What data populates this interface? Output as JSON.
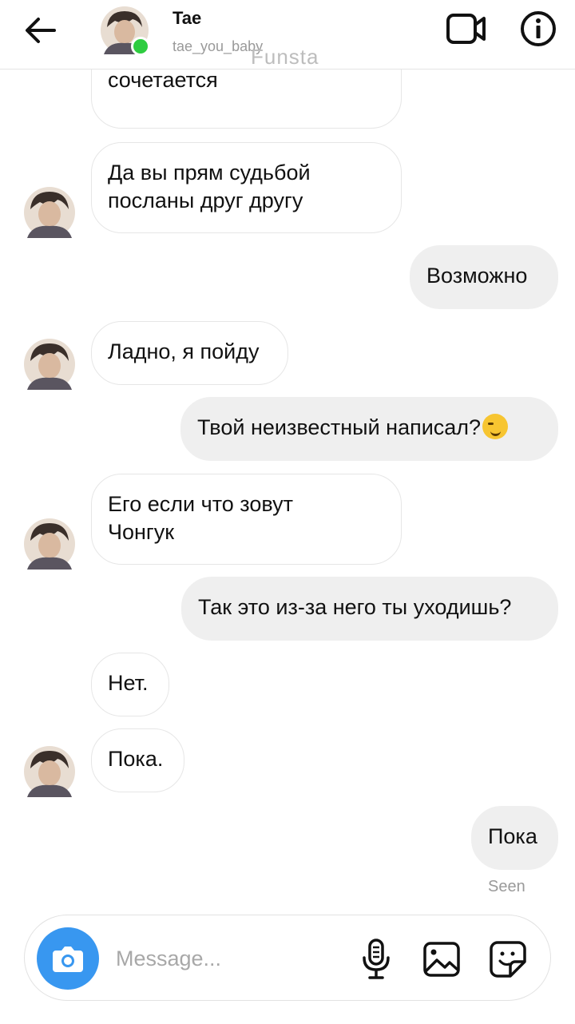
{
  "header": {
    "name": "Tae",
    "username": "tae_you_baby",
    "watermark": "Funsta",
    "icons": [
      "back-arrow-icon",
      "video-camera-icon",
      "info-icon"
    ],
    "online_color": "#2ecc40"
  },
  "messages": [
    {
      "from": "them",
      "text": "карамель прекрасно\nсочетается",
      "avatar": false
    },
    {
      "from": "them",
      "text": "Да вы прям судьбой\nпосланы друг другу",
      "avatar": true
    },
    {
      "from": "me",
      "text": "Возможно"
    },
    {
      "from": "them",
      "text": "Ладно, я пойду",
      "avatar": true
    },
    {
      "from": "me",
      "text": "Твой неизвестный написал?",
      "emoji": "smirking-face"
    },
    {
      "from": "them",
      "text": "Его если что зовут\nЧонгук",
      "avatar": true
    },
    {
      "from": "me",
      "text": "Так это из-за него ты уходишь?"
    },
    {
      "from": "them",
      "text": "Нет.",
      "avatar": false
    },
    {
      "from": "them",
      "text": "Пока.",
      "avatar": true
    },
    {
      "from": "me",
      "text": "Пока"
    }
  ],
  "seen_label": "Seen",
  "composer": {
    "placeholder": "Message...",
    "icons": [
      "camera-icon",
      "microphone-icon",
      "gallery-icon",
      "sticker-icon"
    ],
    "accent": "#3897f0"
  }
}
